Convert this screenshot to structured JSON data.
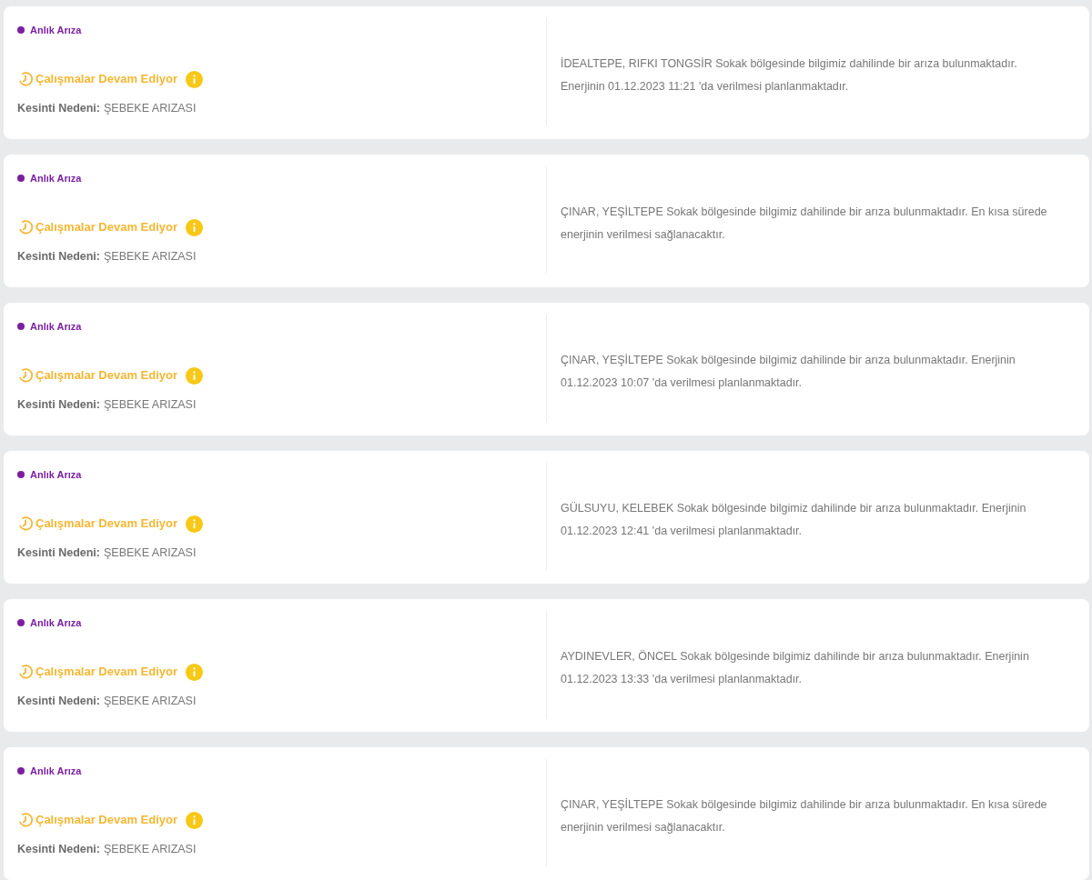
{
  "outages": [
    {
      "type": "Anlık Arıza",
      "color": "#7b1fa2",
      "status": "Çalışmalar Devam Ediyor",
      "reason_label": "Kesinti Nedeni:",
      "reason": "ŞEBEKE ARIZASI",
      "description": "İDEALTEPE, RIFKI TONGSİR Sokak bölgesinde bilgimiz dahilinde bir arıza bulunmaktadır. Enerjinin 01.12.2023 11:21 'da verilmesi planlanmaktadır."
    },
    {
      "type": "Anlık Arıza",
      "color": "#7b1fa2",
      "status": "Çalışmalar Devam Ediyor",
      "reason_label": "Kesinti Nedeni:",
      "reason": "ŞEBEKE ARIZASI",
      "description": "ÇINAR, YEŞİLTEPE Sokak bölgesinde bilgimiz dahilinde bir arıza bulunmaktadır. En kısa sürede enerjinin verilmesi sağlanacaktır."
    },
    {
      "type": "Anlık Arıza",
      "color": "#7b1fa2",
      "status": "Çalışmalar Devam Ediyor",
      "reason_label": "Kesinti Nedeni:",
      "reason": "ŞEBEKE ARIZASI",
      "description": "ÇINAR, YEŞİLTEPE Sokak bölgesinde bilgimiz dahilinde bir arıza bulunmaktadır. Enerjinin 01.12.2023 10:07 'da verilmesi planlanmaktadır."
    },
    {
      "type": "Anlık Arıza",
      "color": "#7b1fa2",
      "status": "Çalışmalar Devam Ediyor",
      "reason_label": "Kesinti Nedeni:",
      "reason": "ŞEBEKE ARIZASI",
      "description": "GÜLSUYU, KELEBEK Sokak bölgesinde bilgimiz dahilinde bir arıza bulunmaktadır. Enerjinin 01.12.2023 12:41 'da verilmesi planlanmaktadır."
    },
    {
      "type": "Anlık Arıza",
      "color": "#7b1fa2",
      "status": "Çalışmalar Devam Ediyor",
      "reason_label": "Kesinti Nedeni:",
      "reason": "ŞEBEKE ARIZASI",
      "description": "AYDINEVLER, ÖNCEL Sokak bölgesinde bilgimiz dahilinde bir arıza bulunmaktadır. Enerjinin 01.12.2023 13:33 'da verilmesi planlanmaktadır."
    },
    {
      "type": "Anlık Arıza",
      "color": "#7b1fa2",
      "status": "Çalışmalar Devam Ediyor",
      "reason_label": "Kesinti Nedeni:",
      "reason": "ŞEBEKE ARIZASI",
      "description": "ÇINAR, YEŞİLTEPE Sokak bölgesinde bilgimiz dahilinde bir arıza bulunmaktadır. En kısa sürede enerjinin verilmesi sağlanacaktır."
    }
  ]
}
